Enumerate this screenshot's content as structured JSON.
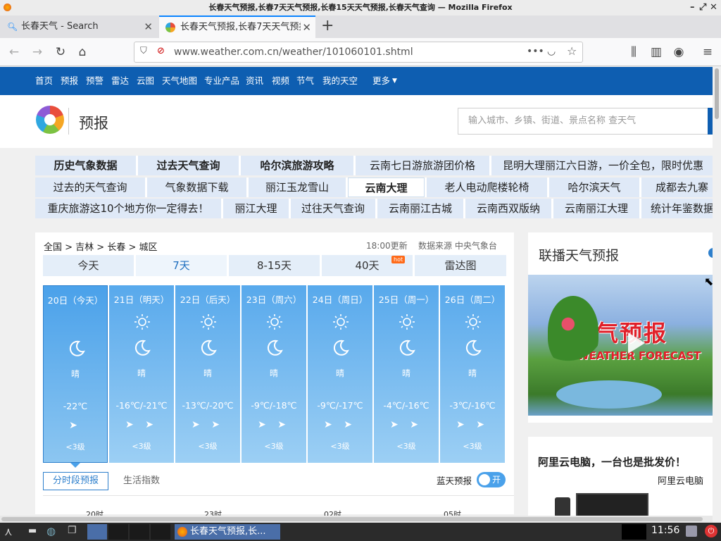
{
  "window": {
    "title": "长春天气预报,长春7天天气预报,长春15天天气预报,长春天气查询 — Mozilla Firefox"
  },
  "tabs": [
    {
      "label": "长春天气 - Search"
    },
    {
      "label": "长春天气预报,长春7天天气预报"
    }
  ],
  "urlbar": {
    "url": "www.weather.com.cn/weather/101060101.shtml"
  },
  "site_nav": [
    "首页",
    "预报",
    "预警",
    "雷达",
    "云图",
    "天气地图",
    "专业产品",
    "资讯",
    "视频",
    "节气",
    "我的天空",
    "更多"
  ],
  "header": {
    "section_title": "预报",
    "search_placeholder": "输入城市、乡镇、街道、景点名称 查天气"
  },
  "ad_rows": [
    [
      "历史气象数据",
      "过去天气查询",
      "哈尔滨旅游攻略",
      "云南七日游旅游团价格",
      "昆明大理丽江六日游，一价全包，限时优惠"
    ],
    [
      "过去的天气查询",
      "气象数据下载",
      "丽江玉龙雪山",
      "云南大理",
      "老人电动爬楼轮椅",
      "哈尔滨天气",
      "成都去九寨"
    ],
    [
      "重庆旅游这10个地方你一定得去！",
      "丽江大理",
      "过往天气查询",
      "云南丽江古城",
      "云南西双版纳",
      "云南丽江大理",
      "统计年鉴数据"
    ]
  ],
  "forecast": {
    "breadcrumb": "全国 > 吉林 > 长春 > 城区",
    "update": "18:00更新",
    "source": "数据来源 中央气象台",
    "tabs": [
      "今天",
      "7天",
      "8-15天",
      "40天",
      "雷达图"
    ],
    "hot_badge": "hot",
    "days": [
      {
        "date": "20日（今天）",
        "weather": "晴",
        "temp": "-22℃",
        "wind": "➤",
        "level": "<3级"
      },
      {
        "date": "21日（明天）",
        "weather": "晴",
        "temp": "-16℃/-21℃",
        "wind": "➤ ➤",
        "level": "<3级"
      },
      {
        "date": "22日（后天）",
        "weather": "晴",
        "temp": "-13℃/-20℃",
        "wind": "➤ ➤",
        "level": "<3级"
      },
      {
        "date": "23日（周六）",
        "weather": "晴",
        "temp": "-9℃/-18℃",
        "wind": "➤ ➤",
        "level": "<3级"
      },
      {
        "date": "24日（周日）",
        "weather": "晴",
        "temp": "-9℃/-17℃",
        "wind": "➤ ➤",
        "level": "<3级"
      },
      {
        "date": "25日（周一）",
        "weather": "晴",
        "temp": "-4℃/-16℃",
        "wind": "➤ ➤",
        "level": "<3级"
      },
      {
        "date": "26日（周二）",
        "weather": "晴",
        "temp": "-3℃/-16℃",
        "wind": "➤ ➤",
        "level": "<3级"
      }
    ],
    "sub_tabs": [
      "分时段预报",
      "生活指数"
    ],
    "blue_sky_label": "蓝天预报",
    "toggle_label": "开",
    "hour_labels": [
      "20时",
      "23时",
      "02时",
      "05时"
    ]
  },
  "right": {
    "video_title": "联播天气预报",
    "video_caption": "天气预报",
    "video_caption_en": "WEATHER FORECAST",
    "ad_title": "阿里云电脑，一台也是批发价！",
    "ad_brand": "阿里云电脑"
  },
  "taskbar": {
    "clock": "11:56",
    "task_label": "长春天气预报,长..."
  },
  "colors": {
    "brand_blue": "#0e5eb1",
    "firefox_blue": "#0a84ff"
  }
}
